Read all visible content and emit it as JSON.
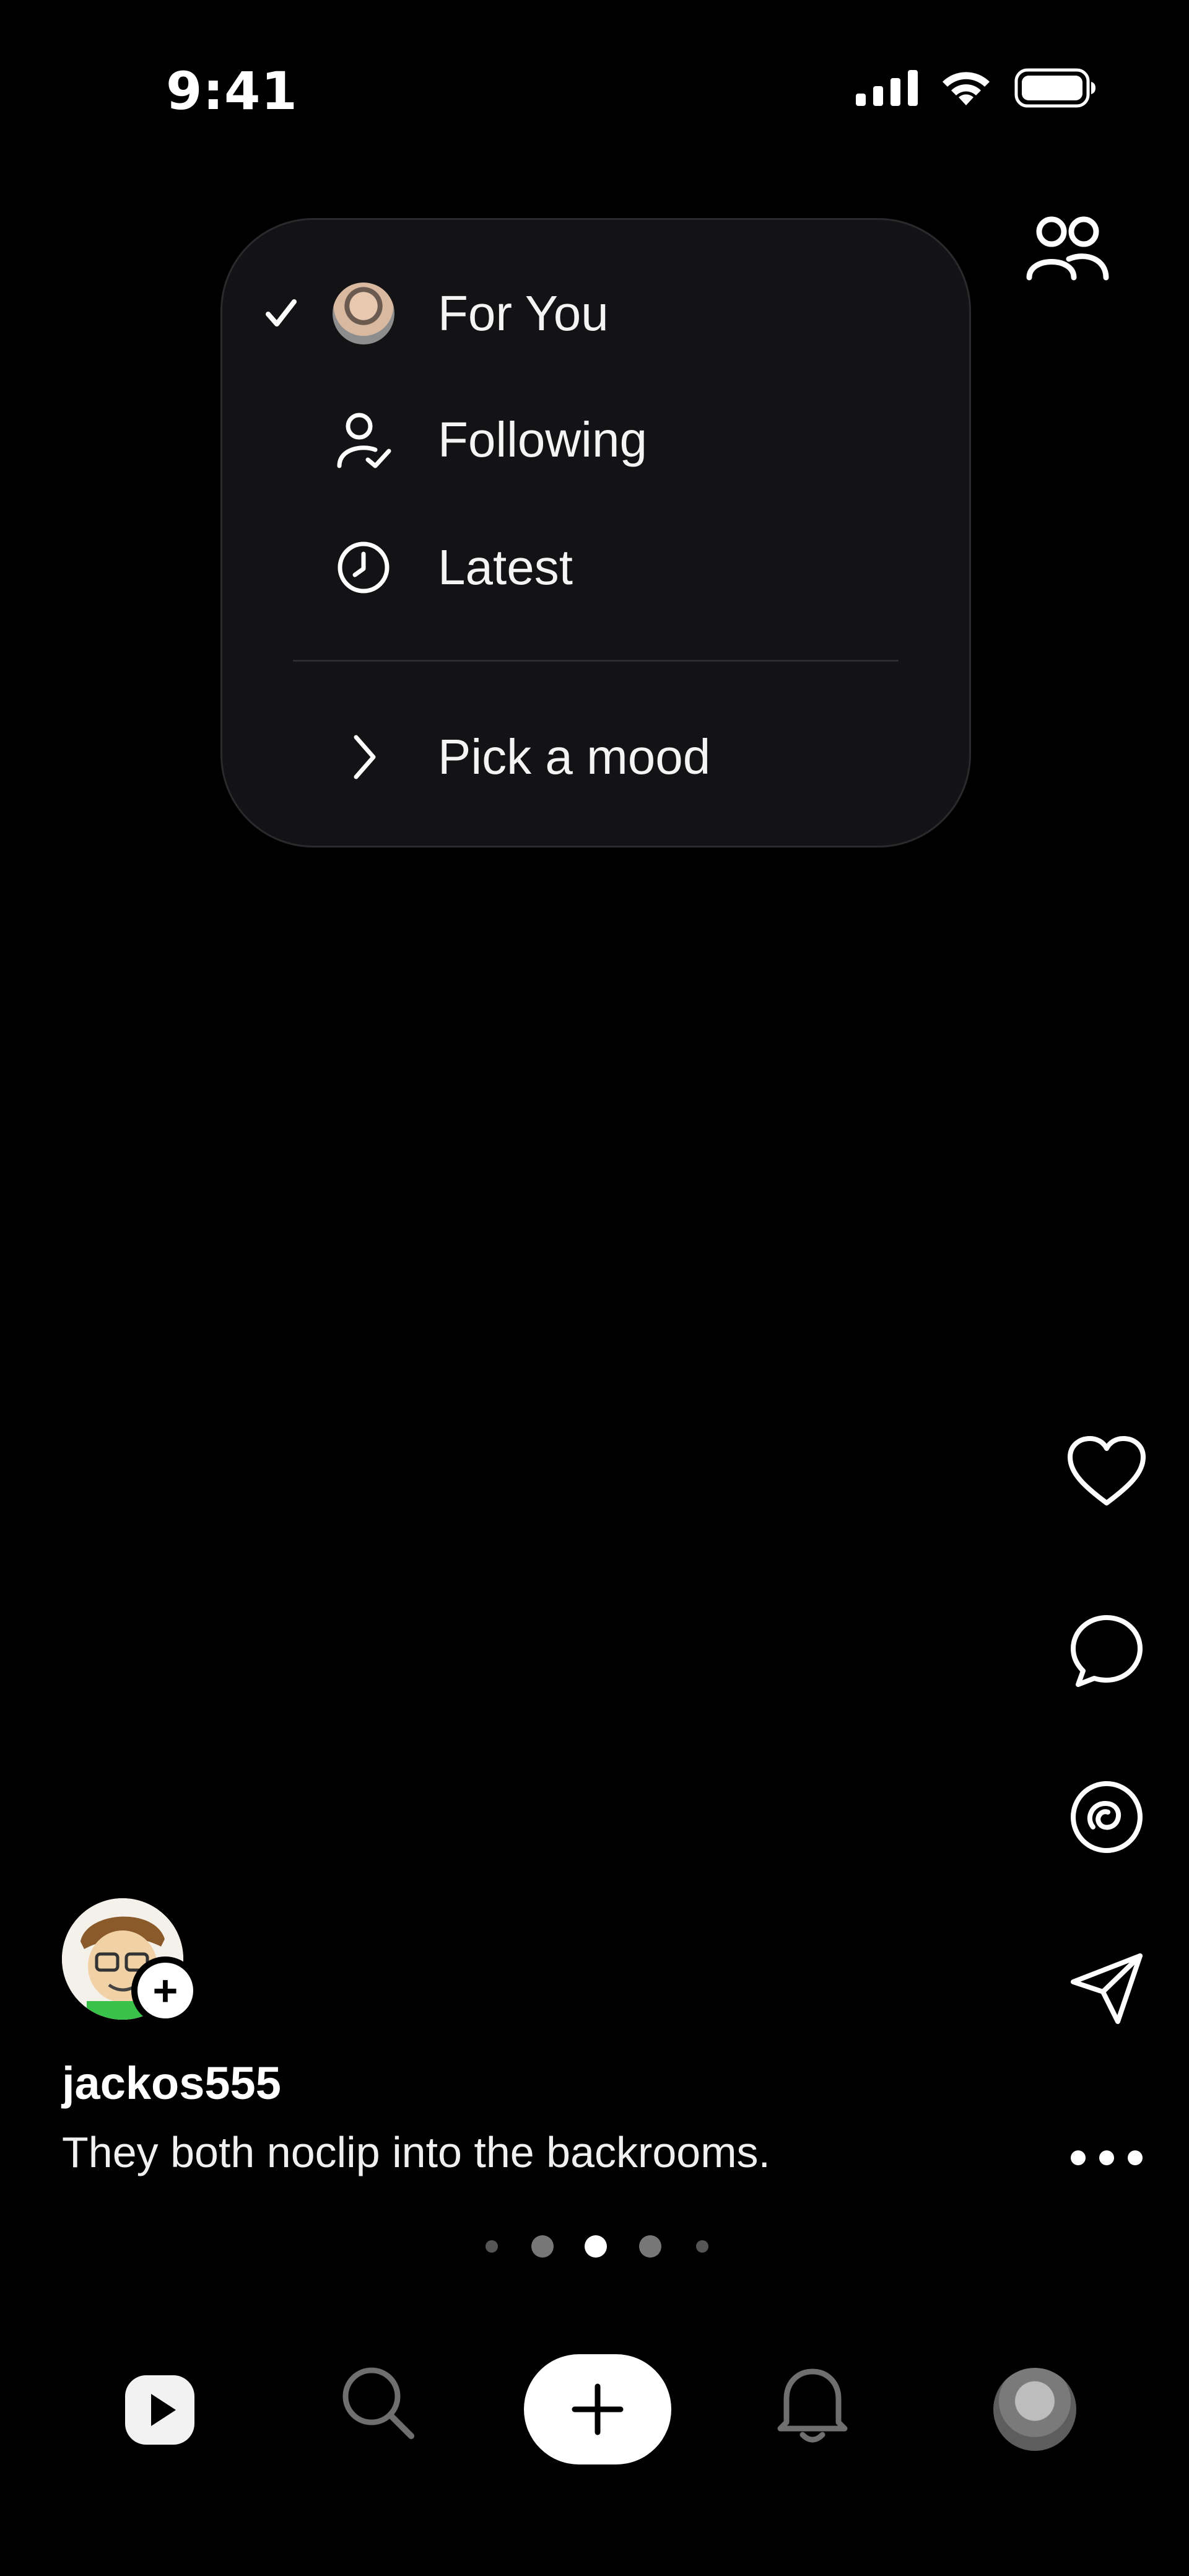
{
  "status_bar": {
    "time": "9:41",
    "icons": [
      "cellular-signal-icon",
      "wifi-icon",
      "battery-icon"
    ]
  },
  "header": {
    "people_icon": "people-icon"
  },
  "feed_menu": {
    "items": [
      {
        "label": "For You",
        "icon": "avatar",
        "selected": true
      },
      {
        "label": "Following",
        "icon": "person-check-icon",
        "selected": false
      },
      {
        "label": "Latest",
        "icon": "clock-icon",
        "selected": false
      }
    ],
    "mood": {
      "label": "Pick a mood",
      "icon": "chevron-right-icon"
    }
  },
  "post": {
    "username": "jackos555",
    "caption": "They both noclip into the backrooms.",
    "follow_label": "+"
  },
  "actions": [
    "heart-icon",
    "comment-icon",
    "remix-icon",
    "send-icon",
    "more-icon"
  ],
  "pager": {
    "count": 5,
    "active_index": 2
  },
  "tab_bar": {
    "items": [
      "reels-icon",
      "search-icon",
      "create-button",
      "notifications-icon",
      "profile-avatar"
    ]
  },
  "colors": {
    "background": "#000000",
    "menu_bg": "#131315",
    "text": "#ffffff"
  }
}
